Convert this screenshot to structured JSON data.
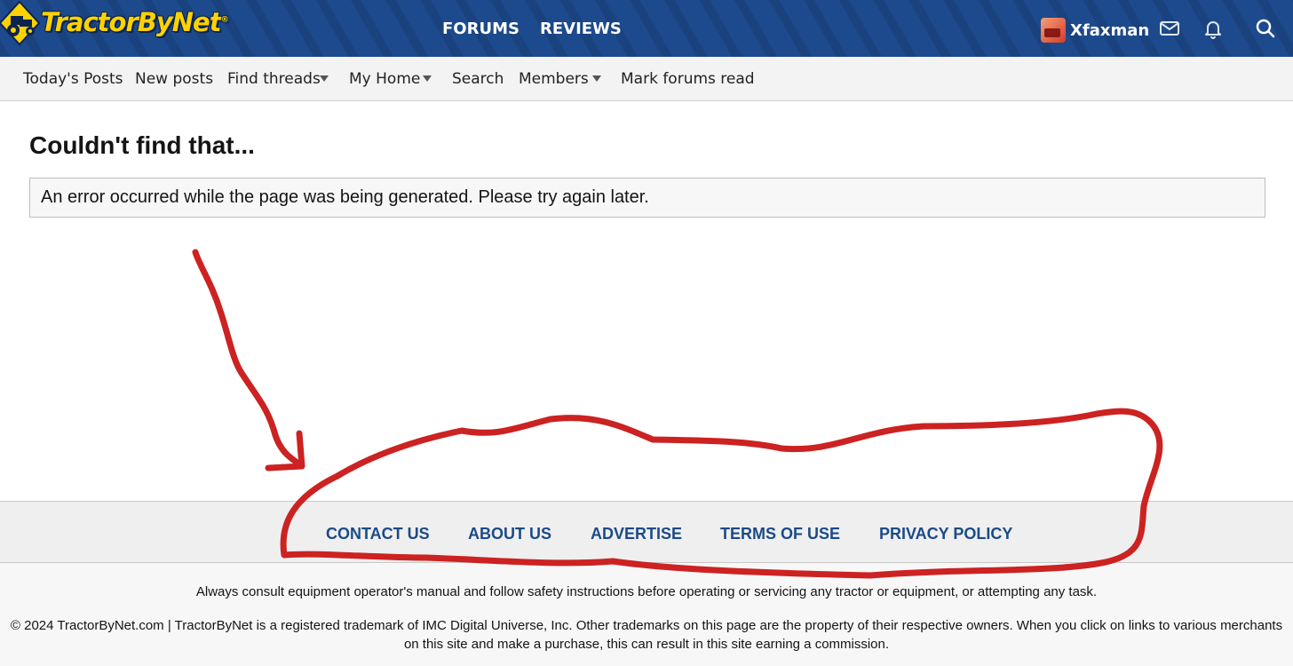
{
  "header": {
    "logo_text": "TractorByNet",
    "logo_mark": "®",
    "nav": [
      {
        "label": "FORUMS"
      },
      {
        "label": "REVIEWS"
      }
    ],
    "username": "Xfaxman",
    "icons": [
      "inbox-icon",
      "bell-icon",
      "search-icon"
    ],
    "brand_color": "#1d4a8c",
    "logo_color": "#ffd200"
  },
  "subnav": {
    "items": [
      {
        "label": "Today's Posts"
      },
      {
        "label": "New posts"
      },
      {
        "label": "Find threads"
      },
      {
        "label": "My Home"
      },
      {
        "label": "Search"
      },
      {
        "label": "Members"
      },
      {
        "label": "Mark forums read"
      }
    ]
  },
  "main": {
    "title": "Couldn't find that...",
    "error_message": "An error occurred while the page was being generated. Please try again later."
  },
  "footer": {
    "links": [
      {
        "label": "CONTACT US"
      },
      {
        "label": "ABOUT US"
      },
      {
        "label": "ADVERTISE"
      },
      {
        "label": "TERMS OF USE"
      },
      {
        "label": "PRIVACY POLICY"
      }
    ],
    "link_color": "#1b4a87",
    "disclaimer": "Always consult equipment operator's manual and follow safety instructions before operating or servicing any tractor or equipment, or attempting any task.",
    "copyright": "© 2024 TractorByNet.com | TractorByNet is a registered trademark of IMC Digital Universe, Inc. Other trademarks on this page are the property of their respective owners. When you click on links to various merchants on this site and make a purchase, this can result in this site earning a commission."
  },
  "annotation_color": "#cc2222"
}
